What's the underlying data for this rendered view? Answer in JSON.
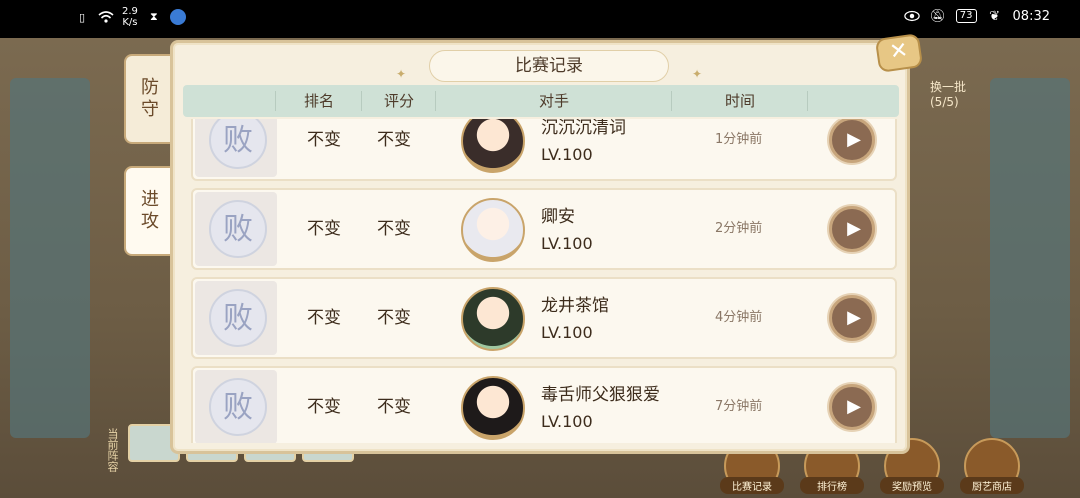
{
  "status_bar": {
    "network_speed_value": "2.9",
    "network_speed_unit": "K/s",
    "battery": "73",
    "time": "08:32"
  },
  "background": {
    "hud_text_1": "换一批",
    "hud_text_2": "(5/5)",
    "side_text": "当前阵容",
    "bottom_buttons": [
      "比赛记录",
      "排行榜",
      "奖励预览",
      "厨艺商店"
    ]
  },
  "tabs": [
    {
      "label": "防守"
    },
    {
      "label": "进攻"
    }
  ],
  "dialog": {
    "title": "比赛记录",
    "headers": {
      "rank": "排名",
      "score": "评分",
      "opponent": "对手",
      "time": "时间"
    },
    "rows": [
      {
        "result": "败",
        "rank": "不变",
        "score": "不变",
        "name": "沉沉沉清词",
        "level": "LV.100",
        "time": "1分钟前"
      },
      {
        "result": "败",
        "rank": "不变",
        "score": "不变",
        "name": "卿安",
        "level": "LV.100",
        "time": "2分钟前"
      },
      {
        "result": "败",
        "rank": "不变",
        "score": "不变",
        "name": "龙井茶馆",
        "level": "LV.100",
        "time": "4分钟前"
      },
      {
        "result": "败",
        "rank": "不变",
        "score": "不变",
        "name": "毒舌师父狠狠爱",
        "level": "LV.100",
        "time": "7分钟前"
      }
    ]
  },
  "icons": {
    "play": "play-icon",
    "close": "close-icon"
  }
}
